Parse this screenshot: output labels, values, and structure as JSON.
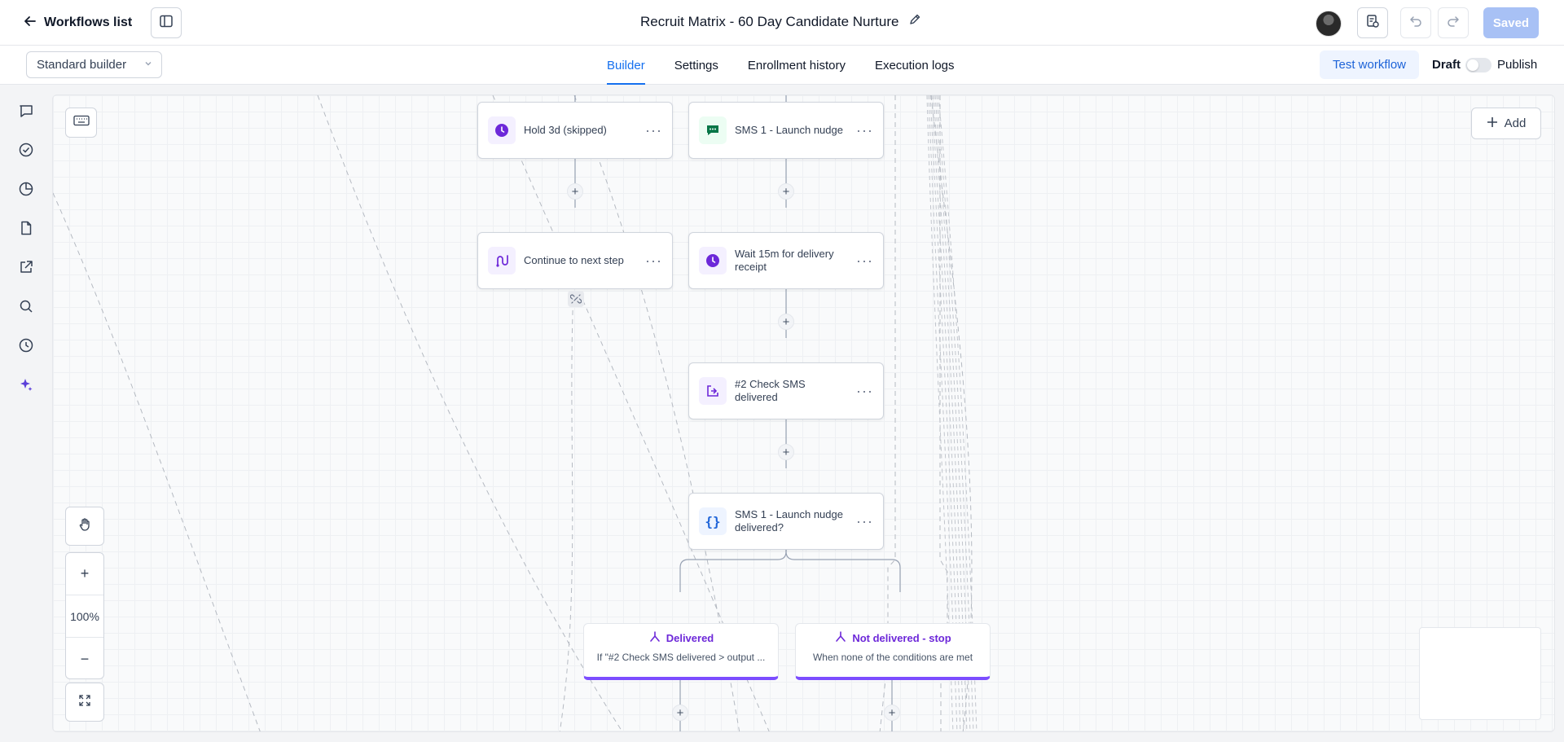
{
  "header": {
    "back_label": "Workflows list",
    "workflow_title": "Recruit Matrix - 60 Day Candidate Nurture",
    "saved_label": "Saved"
  },
  "subbar": {
    "builder_mode": "Standard builder",
    "tabs": [
      {
        "label": "Builder",
        "active": true
      },
      {
        "label": "Settings",
        "active": false
      },
      {
        "label": "Enrollment history",
        "active": false
      },
      {
        "label": "Execution logs",
        "active": false
      }
    ],
    "test_workflow_label": "Test workflow",
    "draft_label": "Draft",
    "publish_label": "Publish",
    "published": false
  },
  "left_rail": [
    "chat-icon",
    "check-circle-icon",
    "pie-chart-icon",
    "file-icon",
    "external-link-icon",
    "search-icon",
    "history-icon",
    "sparkle-icon"
  ],
  "canvas": {
    "add_label": "Add",
    "zoom_label": "100%",
    "nodes": {
      "hold": {
        "label": "Hold 3d (skipped)",
        "icon": "clock-icon"
      },
      "sms1": {
        "label": "SMS 1 - Launch nudge",
        "icon": "sms-icon"
      },
      "continue": {
        "label": "Continue to next step",
        "icon": "goto-icon"
      },
      "wait": {
        "label": "Wait 15m for delivery receipt",
        "icon": "clock-icon"
      },
      "check": {
        "label": "#2 Check SMS delivered",
        "icon": "webhook-icon"
      },
      "condition": {
        "label": "SMS 1 - Launch nudge delivered?",
        "icon": "braces-icon"
      }
    },
    "branches": {
      "delivered": {
        "title": "Delivered",
        "subtitle": "If \"#2 Check SMS delivered > output ..."
      },
      "not_delivered": {
        "title": "Not delivered - stop",
        "subtitle": "When none of the conditions are met"
      }
    }
  },
  "colors": {
    "accent": "#1570ef",
    "branch_accent": "#7c4dff",
    "clock_purple": "#6d28d9",
    "sms_green": "#067647",
    "saved_bg": "#a8c1f5"
  }
}
